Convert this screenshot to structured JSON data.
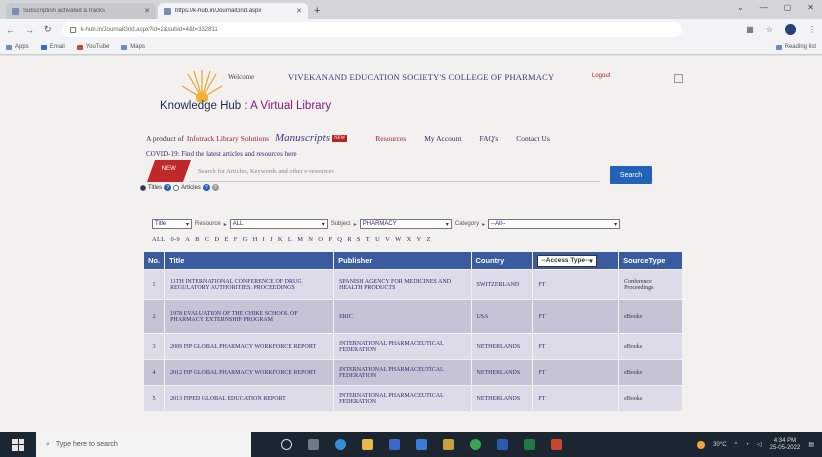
{
  "browser": {
    "tabs": [
      {
        "label": "Subscription activated & tracks"
      },
      {
        "label": "https://k-hub.in/JournalGrid.aspx"
      }
    ],
    "new_tab": "+",
    "url": "k-hub.in/JournalGrid.aspx?id=2&subid=4&t=332811",
    "bookmarks": [
      "Apps",
      "Email",
      "YouTube",
      "Maps"
    ],
    "reading_list": "Reading list"
  },
  "header": {
    "welcome": "Welcome",
    "college": "VIVEKANAND EDUCATION SOCIETY'S COLLEGE OF PHARMACY",
    "logout": "Logout",
    "logo_main": "Knowledge Hub",
    "logo_sep": " : ",
    "logo_sub": "A Virtual Library"
  },
  "nav": {
    "product_of": "A product of",
    "brand": "Infotrack Library Solutions",
    "manuscripts": "Manuscripts",
    "new_badge": "NEW",
    "resources": "Resources",
    "my_account": "My Account",
    "faqs": "FAQ's",
    "contact": "Contact Us"
  },
  "covid_text": "COVID-19: Find the latest articles and resources here",
  "search": {
    "ribbon": "NEW",
    "placeholder": "Search for Articles, Keywords and other e-resources",
    "button": "Search",
    "option_titles": "Titles",
    "option_articles": "Articles"
  },
  "filters": {
    "field": "Title",
    "resource_label": "Resource",
    "resource_value": "ALL",
    "subject_label": "Subject",
    "subject_value": "PHARMACY",
    "category_label": "Category",
    "category_value": "--All--"
  },
  "alphabet": [
    "ALL",
    "0-9",
    "A",
    "B",
    "C",
    "D",
    "E",
    "F",
    "G",
    "H",
    "I",
    "J",
    "K",
    "L",
    "M",
    "N",
    "O",
    "P",
    "Q",
    "R",
    "S",
    "T",
    "U",
    "V",
    "W",
    "X",
    "Y",
    "Z"
  ],
  "table": {
    "headers": {
      "no": "No.",
      "title": "Title",
      "publisher": "Publisher",
      "country": "Country",
      "access": "--Access Type--",
      "source": "SourceType"
    },
    "rows": [
      {
        "no": "1",
        "title": "11TH INTERNATIONAL CONFERENCE OF DRUG REGULATORY AUTHORITIES: PROCEEDINGS",
        "publisher": "SPANISH AGENCY FOR MEDICINES AND HEALTH PRODUCTS",
        "country": "SWITZERLAND",
        "access": "FT",
        "source": "Conference Proceedings"
      },
      {
        "no": "2",
        "title": "1978 EVALUATION OF THE CHIKE SCHOOL OF PHARMACY EXTERNSHIP PROGRAM",
        "publisher": "ERIC",
        "country": "USA",
        "access": "FT",
        "source": "eBooks"
      },
      {
        "no": "3",
        "title": "2009 FIP GLOBAL PHARMACY WORKFORCE REPORT",
        "publisher": "INTERNATIONAL PHARMACEUTICAL FEDERATION",
        "country": "NETHERLANDS",
        "access": "FT",
        "source": "eBooks"
      },
      {
        "no": "4",
        "title": "2012 FIP GLOBAL PHARMACY WORKFORCE REPORT",
        "publisher": "INTERNATIONAL PHARMACEUTICAL FEDERATION",
        "country": "NETHERLANDS",
        "access": "FT",
        "source": "eBooks"
      },
      {
        "no": "5",
        "title": "2013 FIPED GLOBAL EDUCATION REPORT",
        "publisher": "INTERNATIONAL PHARMACEUTICAL FEDERATION",
        "country": "NETHERLANDS",
        "access": "FT",
        "source": "eBooks"
      }
    ]
  },
  "taskbar": {
    "search_placeholder": "Type here to search",
    "weather": "30°C",
    "time": "4:34 PM",
    "date": "25-05-2022"
  },
  "colors": {
    "header_blue": "#3a5ba0",
    "search_button": "#2462b8",
    "ribbon_red": "#c0282a"
  }
}
